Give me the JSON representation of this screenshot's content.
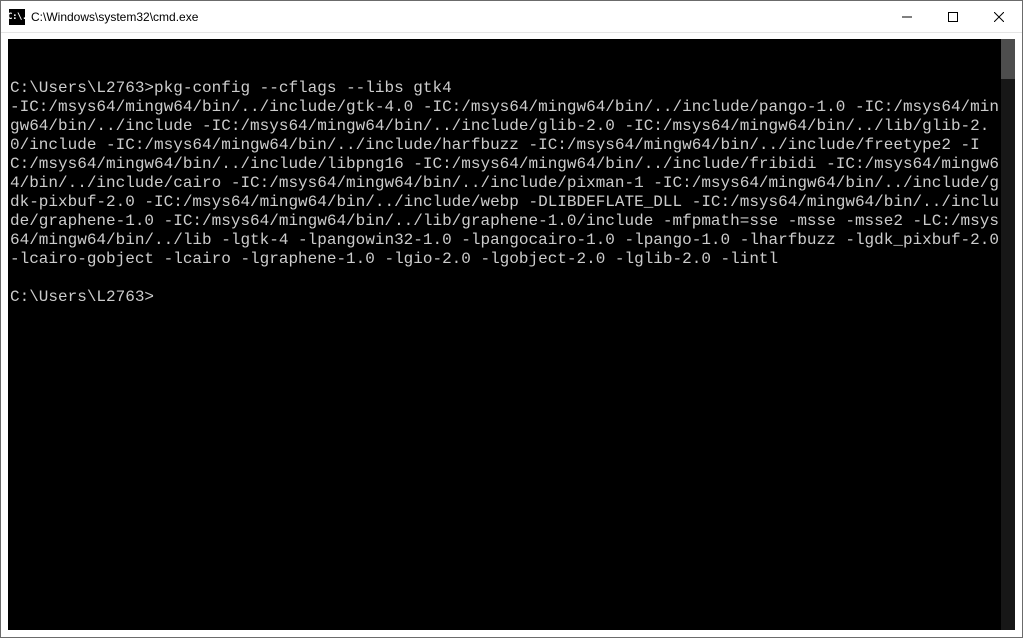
{
  "window": {
    "icon_text": "C:\\.",
    "title": "C:\\Windows\\system32\\cmd.exe"
  },
  "terminal": {
    "prompt1": "C:\\Users\\L2763>",
    "command1": "pkg-config --cflags --libs gtk4",
    "output": "-IC:/msys64/mingw64/bin/../include/gtk-4.0 -IC:/msys64/mingw64/bin/../include/pango-1.0 -IC:/msys64/mingw64/bin/../include -IC:/msys64/mingw64/bin/../include/glib-2.0 -IC:/msys64/mingw64/bin/../lib/glib-2.0/include -IC:/msys64/mingw64/bin/../include/harfbuzz -IC:/msys64/mingw64/bin/../include/freetype2 -IC:/msys64/mingw64/bin/../include/libpng16 -IC:/msys64/mingw64/bin/../include/fribidi -IC:/msys64/mingw64/bin/../include/cairo -IC:/msys64/mingw64/bin/../include/pixman-1 -IC:/msys64/mingw64/bin/../include/gdk-pixbuf-2.0 -IC:/msys64/mingw64/bin/../include/webp -DLIBDEFLATE_DLL -IC:/msys64/mingw64/bin/../include/graphene-1.0 -IC:/msys64/mingw64/bin/../lib/graphene-1.0/include -mfpmath=sse -msse -msse2 -LC:/msys64/mingw64/bin/../lib -lgtk-4 -lpangowin32-1.0 -lpangocairo-1.0 -lpango-1.0 -lharfbuzz -lgdk_pixbuf-2.0 -lcairo-gobject -lcairo -lgraphene-1.0 -lgio-2.0 -lgobject-2.0 -lglib-2.0 -lintl",
    "prompt2": "C:\\Users\\L2763>"
  }
}
